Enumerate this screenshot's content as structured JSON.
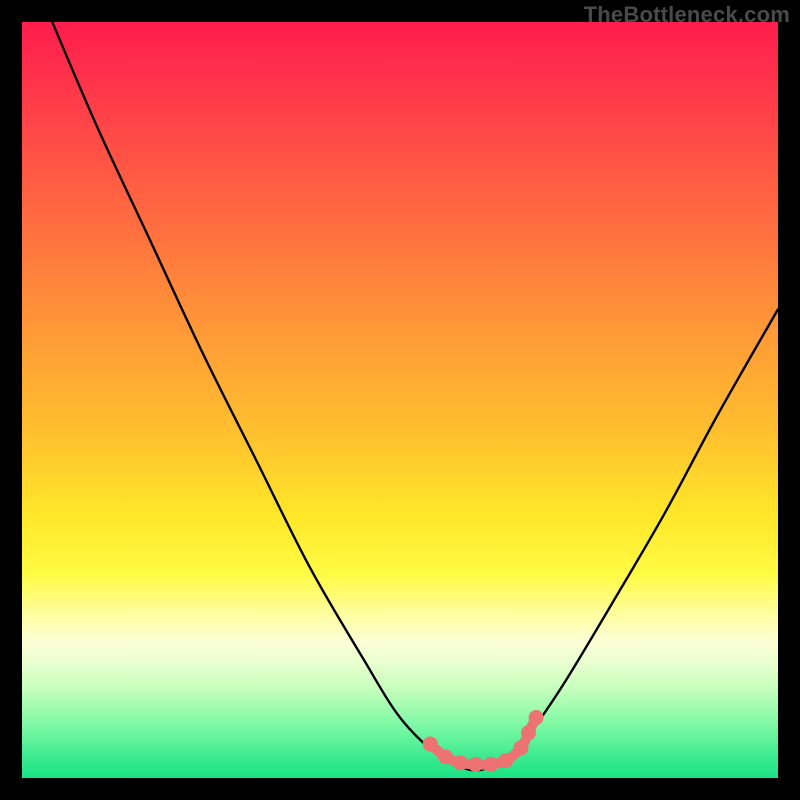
{
  "watermark": "TheBottleneck.com",
  "chart_data": {
    "type": "line",
    "title": "",
    "xlabel": "",
    "ylabel": "",
    "xlim": [
      0,
      100
    ],
    "ylim": [
      0,
      100
    ],
    "series": [
      {
        "name": "bottleneck-curve",
        "x": [
          4,
          10,
          17,
          24,
          31,
          38,
          45,
          50,
          55,
          58,
          60,
          62,
          65,
          68,
          72,
          78,
          85,
          92,
          100
        ],
        "values": [
          100,
          86,
          71,
          56,
          42,
          28,
          16,
          8,
          3,
          1.5,
          1,
          1.5,
          3,
          7,
          13,
          23,
          35,
          48,
          62
        ]
      }
    ],
    "markers": {
      "name": "highlight-dots",
      "color": "#ed7272",
      "x": [
        54,
        56,
        58,
        60,
        62,
        64,
        66,
        67,
        68
      ],
      "values": [
        4.5,
        2.8,
        2.0,
        1.8,
        1.8,
        2.3,
        4.0,
        6.0,
        8.0
      ]
    }
  }
}
